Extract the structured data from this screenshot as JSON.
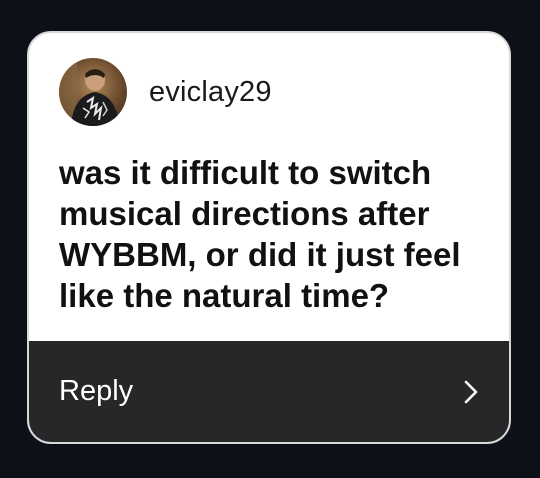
{
  "question_card": {
    "username": "eviclay29",
    "avatar_icon": "user-avatar-photo",
    "question_text": "was it difficult to switch musical directions after WYBBM, or did it just feel like the natural time?",
    "reply_label": "Reply",
    "reply_icon": "chevron-right-icon"
  },
  "colors": {
    "background": "#0d1117",
    "card": "#ffffff",
    "reply_bar": "#262729",
    "text_dark": "#111111",
    "text_light": "#ffffff"
  }
}
